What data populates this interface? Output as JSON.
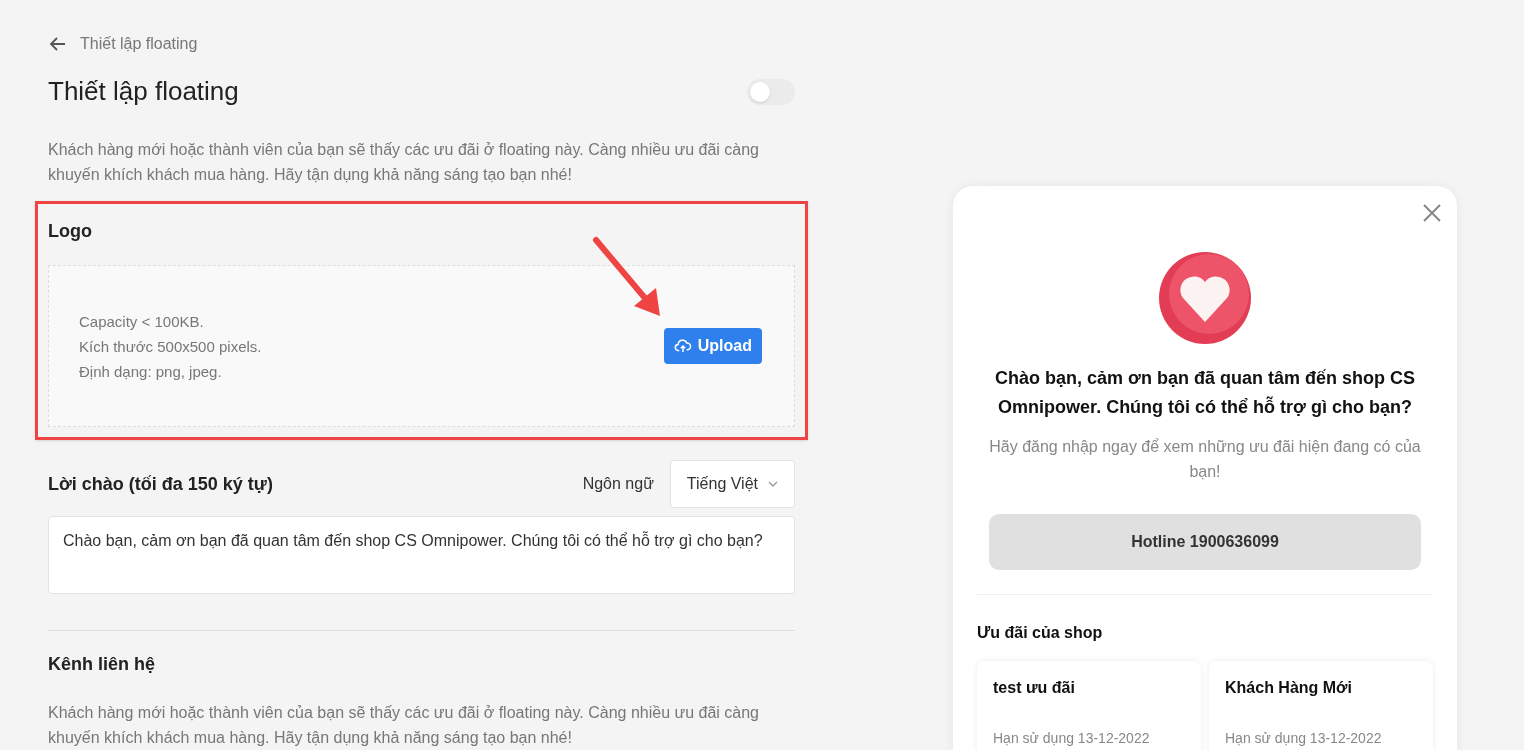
{
  "breadcrumb": {
    "label": "Thiết lập floating"
  },
  "header": {
    "title": "Thiết lập floating",
    "enabled": false
  },
  "intro": "Khách hàng mới hoặc thành viên của bạn sẽ thấy các ưu đãi ở floating này. Càng nhiều ưu đãi càng khuyến khích khách mua hàng. Hãy tận dụng khả năng sáng tạo bạn nhé!",
  "logo": {
    "title": "Logo",
    "hints": [
      "Capacity < 100KB.",
      "Kích thước 500x500 pixels.",
      "Định dạng: png, jpeg."
    ],
    "button": "Upload"
  },
  "greeting": {
    "title": "Lời chào (tối đa 150 ký tự)",
    "language_label": "Ngôn ngữ",
    "language": "Tiếng Việt",
    "value": "Chào bạn, cảm ơn bạn đã quan tâm đến shop CS Omnipower. Chúng tôi có thể hỗ trợ gì cho bạn?"
  },
  "contact": {
    "title": "Kênh liên hệ",
    "description": "Khách hàng mới hoặc thành viên của bạn sẽ thấy các ưu đãi ở floating này. Càng nhiều ưu đãi càng khuyến khích khách mua hàng. Hãy tận dụng khả năng sáng tạo bạn nhé!"
  },
  "preview": {
    "greeting": "Chào bạn, cảm ơn bạn đã quan tâm đến shop CS Omnipower. Chúng tôi có thể hỗ trợ gì cho bạn?",
    "login_prompt": "Hãy đăng nhập ngay để xem những ưu đãi hiện đang có của bạn!",
    "hotline": "Hotline 1900636099",
    "offers_title": "Ưu đãi của shop",
    "offers": [
      {
        "name": "test ưu đãi",
        "expiry": "Hạn sử dụng 13-12-2022"
      },
      {
        "name": "Khách Hàng Mới",
        "expiry": "Hạn sử dụng 13-12-2022"
      }
    ]
  }
}
